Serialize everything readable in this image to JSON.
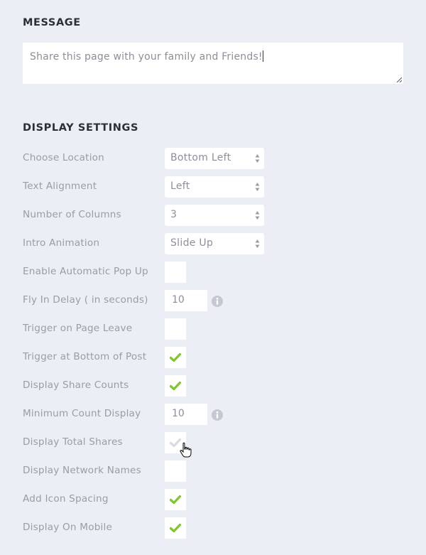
{
  "message": {
    "title": "MESSAGE",
    "value": "Share this page with your family and Friends!"
  },
  "display_settings": {
    "title": "DISPLAY SETTINGS",
    "rows": [
      {
        "label": "Choose Location",
        "type": "select",
        "value": "Bottom Left"
      },
      {
        "label": "Text Alignment",
        "type": "select",
        "value": "Left"
      },
      {
        "label": "Number of Columns",
        "type": "select",
        "value": "3"
      },
      {
        "label": "Intro Animation",
        "type": "select",
        "value": "Slide Up"
      },
      {
        "label": "Enable Automatic Pop Up",
        "type": "checkbox",
        "checked": false
      },
      {
        "label": "Fly In Delay ( in seconds)",
        "type": "number",
        "value": "10",
        "info": "info-icon"
      },
      {
        "label": "Trigger on Page Leave",
        "type": "checkbox",
        "checked": false
      },
      {
        "label": "Trigger at Bottom of Post",
        "type": "checkbox",
        "checked": true
      },
      {
        "label": "Display Share Counts",
        "type": "checkbox",
        "checked": true
      },
      {
        "label": "Minimum Count Display",
        "type": "number",
        "value": "10",
        "info": "info-icon"
      },
      {
        "label": "Display Total Shares",
        "type": "checkbox",
        "checked": false,
        "hover": true
      },
      {
        "label": "Display Network Names",
        "type": "checkbox",
        "checked": false
      },
      {
        "label": "Add Icon Spacing",
        "type": "checkbox",
        "checked": true
      },
      {
        "label": "Display On Mobile",
        "type": "checkbox",
        "checked": true
      }
    ]
  },
  "colors": {
    "background": "#ebeef5",
    "check": "#7cc827",
    "check_hover": "#d8dbe2"
  }
}
